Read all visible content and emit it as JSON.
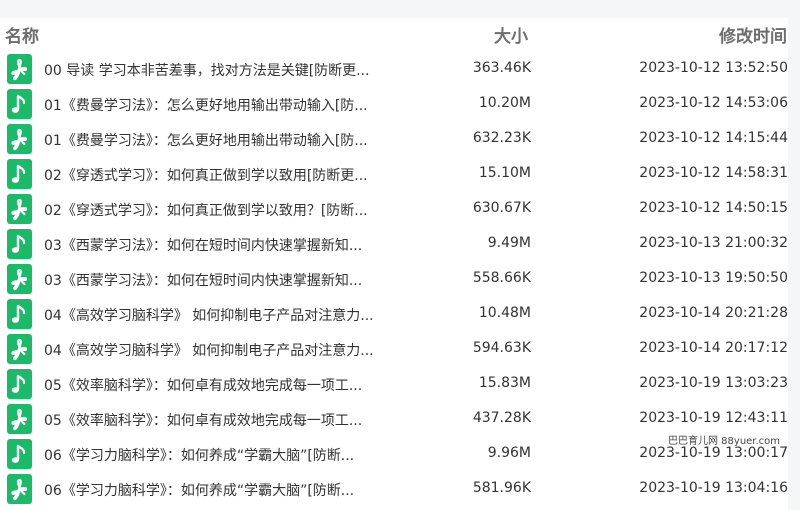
{
  "header": {
    "name_label": "名称",
    "size_label": "大小",
    "time_label": "修改时间"
  },
  "colors": {
    "pdf_icon_bg": "#1bba68",
    "audio_icon_bg": "#1bba68",
    "text": "#333333",
    "header_text": "#6e6e6e"
  },
  "rows": [
    {
      "icon": "pdf-icon",
      "name": "00 导读 学习本非苦差事，找对方法是关键[防断更...",
      "size": "363.46K",
      "time": "2023-10-12 13:52:50"
    },
    {
      "icon": "music-note-icon",
      "name": "01《费曼学习法》：怎么更好地用输出带动输入[防...",
      "size": "10.20M",
      "time": "2023-10-12 14:53:06"
    },
    {
      "icon": "pdf-icon",
      "name": "01《费曼学习法》：怎么更好地用输出带动输入[防...",
      "size": "632.23K",
      "time": "2023-10-12 14:15:44"
    },
    {
      "icon": "music-note-icon",
      "name": "02《穿透式学习》：如何真正做到学以致用[防断更...",
      "size": "15.10M",
      "time": "2023-10-12 14:58:31"
    },
    {
      "icon": "pdf-icon",
      "name": "02《穿透式学习》：如何真正做到学以致用？[防断...",
      "size": "630.67K",
      "time": "2023-10-12 14:50:15"
    },
    {
      "icon": "music-note-icon",
      "name": "03《西蒙学习法》：如何在短时间内快速掌握新知...",
      "size": "9.49M",
      "time": "2023-10-13 21:00:32"
    },
    {
      "icon": "pdf-icon",
      "name": "03《西蒙学习法》：如何在短时间内快速掌握新知...",
      "size": "558.66K",
      "time": "2023-10-13 19:50:50"
    },
    {
      "icon": "music-note-icon",
      "name": "04《高效学习脑科学》 如何抑制电子产品对注意力...",
      "size": "10.48M",
      "time": "2023-10-14 20:21:28"
    },
    {
      "icon": "pdf-icon",
      "name": "04《高效学习脑科学》 如何抑制电子产品对注意力...",
      "size": "594.63K",
      "time": "2023-10-14 20:17:12"
    },
    {
      "icon": "music-note-icon",
      "name": "05《效率脑科学》：如何卓有成效地完成每一项工...",
      "size": "15.83M",
      "time": "2023-10-19 13:03:23"
    },
    {
      "icon": "pdf-icon",
      "name": "05《效率脑科学》：如何卓有成效地完成每一项工...",
      "size": "437.28K",
      "time": "2023-10-19 12:43:11"
    },
    {
      "icon": "music-note-icon",
      "name": "06《学习力脑科学》：如何养成“学霸大脑”[防断...",
      "size": "9.96M",
      "time": "2023-10-19 13:00:17"
    },
    {
      "icon": "pdf-icon",
      "name": "06《学习力脑科学》：如何养成“学霸大脑”[防断...",
      "size": "581.96K",
      "time": "2023-10-19 13:04:16"
    }
  ],
  "watermark": "巴巴育儿网 88yuer.com"
}
